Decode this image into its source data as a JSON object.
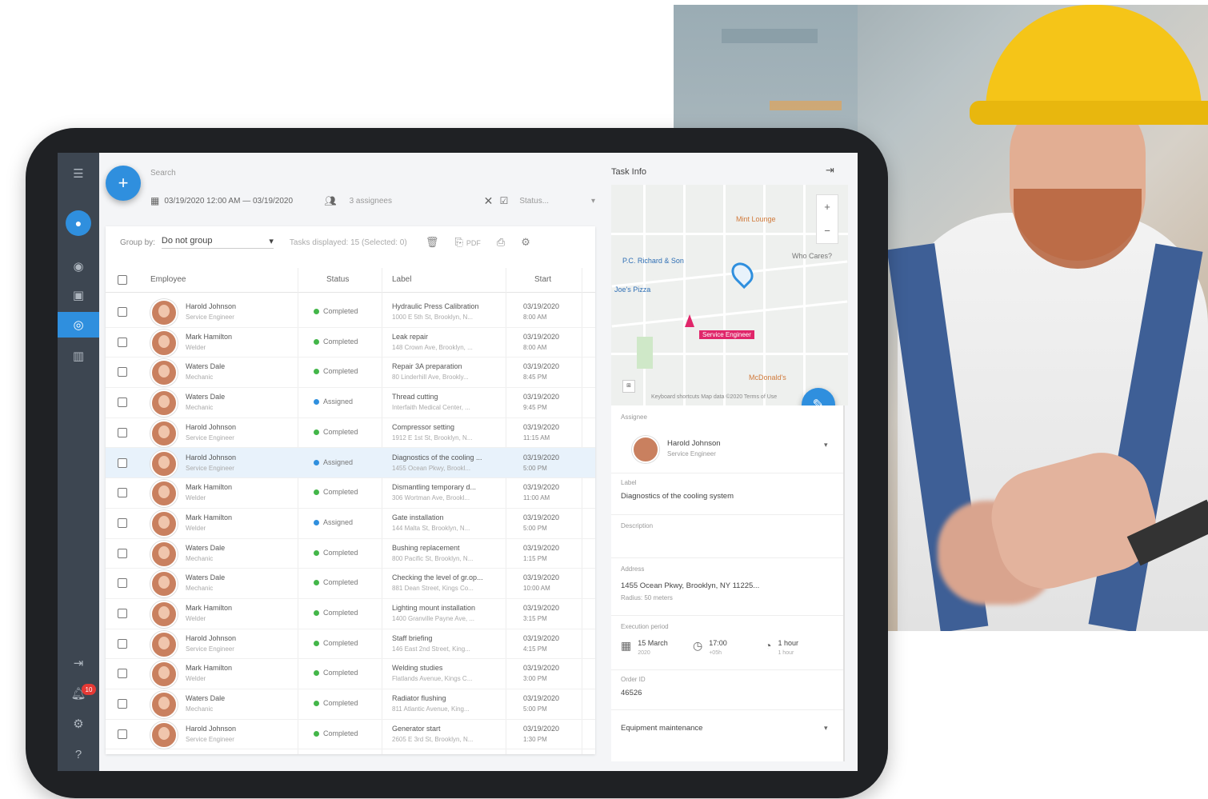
{
  "sidebar": {
    "badge_count": "10"
  },
  "topbar": {
    "search_label": "Search",
    "date_range": "03/19/2020 12:00 AM — 03/19/2020",
    "assignees": "3 assignees",
    "status_placeholder": "Status..."
  },
  "toolbar": {
    "group_by_label": "Group by:",
    "group_by_value": "Do not group",
    "tasks_displayed": "Tasks displayed: 15 (Selected: 0)",
    "pdf_label": "PDF"
  },
  "table": {
    "headers": {
      "employee": "Employee",
      "status": "Status",
      "label": "Label",
      "start": "Start"
    },
    "rows": [
      {
        "name": "Harold Johnson",
        "role": "Service Engineer",
        "status": "Completed",
        "label": "Hydraulic Press Calibration",
        "address": "1000 E 5th St, Brooklyn, N...",
        "date": "03/19/2020",
        "time": "8:00 AM",
        "selected": false
      },
      {
        "name": "Mark Hamilton",
        "role": "Welder",
        "status": "Completed",
        "label": "Leak repair",
        "address": "148 Crown Ave, Brooklyn, ...",
        "date": "03/19/2020",
        "time": "8:00 AM",
        "selected": false
      },
      {
        "name": "Waters Dale",
        "role": "Mechanic",
        "status": "Completed",
        "label": "Repair 3A preparation",
        "address": "80 Linderhill Ave, Brookly...",
        "date": "03/19/2020",
        "time": "8:45 PM",
        "selected": false
      },
      {
        "name": "Waters Dale",
        "role": "Mechanic",
        "status": "Assigned",
        "label": "Thread cutting",
        "address": "Interfaith Medical Center, ...",
        "date": "03/19/2020",
        "time": "9:45 PM",
        "selected": false
      },
      {
        "name": "Harold Johnson",
        "role": "Service Engineer",
        "status": "Completed",
        "label": "Compressor setting",
        "address": "1912 E 1st St, Brooklyn, N...",
        "date": "03/19/2020",
        "time": "11:15 AM",
        "selected": false
      },
      {
        "name": "Harold Johnson",
        "role": "Service Engineer",
        "status": "Assigned",
        "label": "Diagnostics of the cooling ...",
        "address": "1455 Ocean Pkwy, Brookl...",
        "date": "03/19/2020",
        "time": "5:00 PM",
        "selected": true
      },
      {
        "name": "Mark Hamilton",
        "role": "Welder",
        "status": "Completed",
        "label": "Dismantling temporary d...",
        "address": "306 Wortman Ave, Brookl...",
        "date": "03/19/2020",
        "time": "11:00 AM",
        "selected": false
      },
      {
        "name": "Mark Hamilton",
        "role": "Welder",
        "status": "Assigned",
        "label": "Gate installation",
        "address": "144 Malta St, Brooklyn, N...",
        "date": "03/19/2020",
        "time": "5:00 PM",
        "selected": false
      },
      {
        "name": "Waters Dale",
        "role": "Mechanic",
        "status": "Completed",
        "label": "Bushing replacement",
        "address": "800 Pacific St, Brooklyn, N...",
        "date": "03/19/2020",
        "time": "1:15 PM",
        "selected": false
      },
      {
        "name": "Waters Dale",
        "role": "Mechanic",
        "status": "Completed",
        "label": "Checking the level of gr.op...",
        "address": "881 Dean Street, Kings Co...",
        "date": "03/19/2020",
        "time": "10:00 AM",
        "selected": false
      },
      {
        "name": "Mark Hamilton",
        "role": "Welder",
        "status": "Completed",
        "label": "Lighting mount installation",
        "address": "1400 Granville Payne Ave, ...",
        "date": "03/19/2020",
        "time": "3:15 PM",
        "selected": false
      },
      {
        "name": "Harold Johnson",
        "role": "Service Engineer",
        "status": "Completed",
        "label": "Staff briefing",
        "address": "146 East 2nd Street, King...",
        "date": "03/19/2020",
        "time": "4:15 PM",
        "selected": false
      },
      {
        "name": "Mark Hamilton",
        "role": "Welder",
        "status": "Completed",
        "label": "Welding studies",
        "address": "Flatlands Avenue, Kings C...",
        "date": "03/19/2020",
        "time": "3:00 PM",
        "selected": false
      },
      {
        "name": "Waters Dale",
        "role": "Mechanic",
        "status": "Completed",
        "label": "Radiator flushing",
        "address": "811 Atlantic Avenue, King...",
        "date": "03/19/2020",
        "time": "5:00 PM",
        "selected": false
      },
      {
        "name": "Harold Johnson",
        "role": "Service Engineer",
        "status": "Completed",
        "label": "Generator start",
        "address": "2605 E 3rd St, Brooklyn, N...",
        "date": "03/19/2020",
        "time": "1:30 PM",
        "selected": false
      }
    ]
  },
  "task_info": {
    "title": "Task Info",
    "map": {
      "poi_1": "Mint Lounge",
      "poi_2": "P.C. Richard & Son",
      "poi_3": "McDonald's",
      "poi_4": "Joe's Pizza",
      "poi_5": "Who Cares?",
      "marker_label": "Service Engineer",
      "footer": "Keyboard shortcuts  Map data ©2020  Terms of Use"
    },
    "assignee_label": "Assignee",
    "assignee_name": "Harold Johnson",
    "assignee_role": "Service Engineer",
    "label_label": "Label",
    "label_value": "Diagnostics of the cooling system",
    "description_label": "Description",
    "address_label": "Address",
    "address_value": "1455 Ocean Pkwy, Brooklyn, NY 11225...",
    "address_sub": "Radius: 50 meters",
    "period_label": "Execution period",
    "period_date": "15 March",
    "period_year": "2020",
    "period_time": "17:00",
    "period_tz": "+05h",
    "period_duration": "1 hour",
    "period_duration_sub": "1 hour",
    "order_label": "Order ID",
    "order_value": "46526",
    "section_value": "Equipment maintenance"
  },
  "colors": {
    "accent": "#2f8fde",
    "completed": "#43b649",
    "assigned": "#2f8fde",
    "marker": "#e0266a"
  }
}
